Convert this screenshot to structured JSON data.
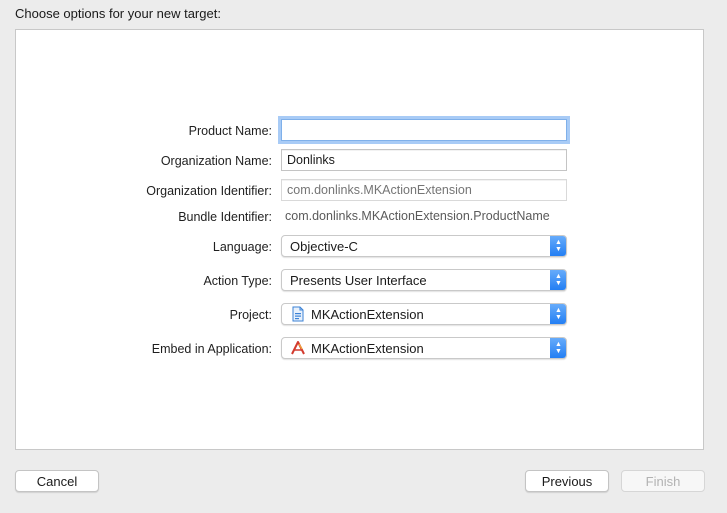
{
  "dialog": {
    "heading": "Choose options for your new target:"
  },
  "form": {
    "product_name": {
      "label": "Product Name:",
      "value": ""
    },
    "organization_name": {
      "label": "Organization Name:",
      "value": "Donlinks"
    },
    "organization_identifier": {
      "label": "Organization Identifier:",
      "placeholder": "com.donlinks.MKActionExtension"
    },
    "bundle_identifier": {
      "label": "Bundle Identifier:",
      "value": "com.donlinks.MKActionExtension.ProductName"
    },
    "language": {
      "label": "Language:",
      "value": "Objective-C"
    },
    "action_type": {
      "label": "Action Type:",
      "value": "Presents User Interface"
    },
    "project": {
      "label": "Project:",
      "value": "MKActionExtension",
      "icon": "xcode-project-icon"
    },
    "embed_in_application": {
      "label": "Embed in Application:",
      "value": "MKActionExtension",
      "icon": "app-target-icon"
    }
  },
  "buttons": {
    "cancel": "Cancel",
    "previous": "Previous",
    "finish": "Finish"
  },
  "colors": {
    "focus_ring": "#60a0ee",
    "popup_arrow": "#1f7cf3"
  }
}
